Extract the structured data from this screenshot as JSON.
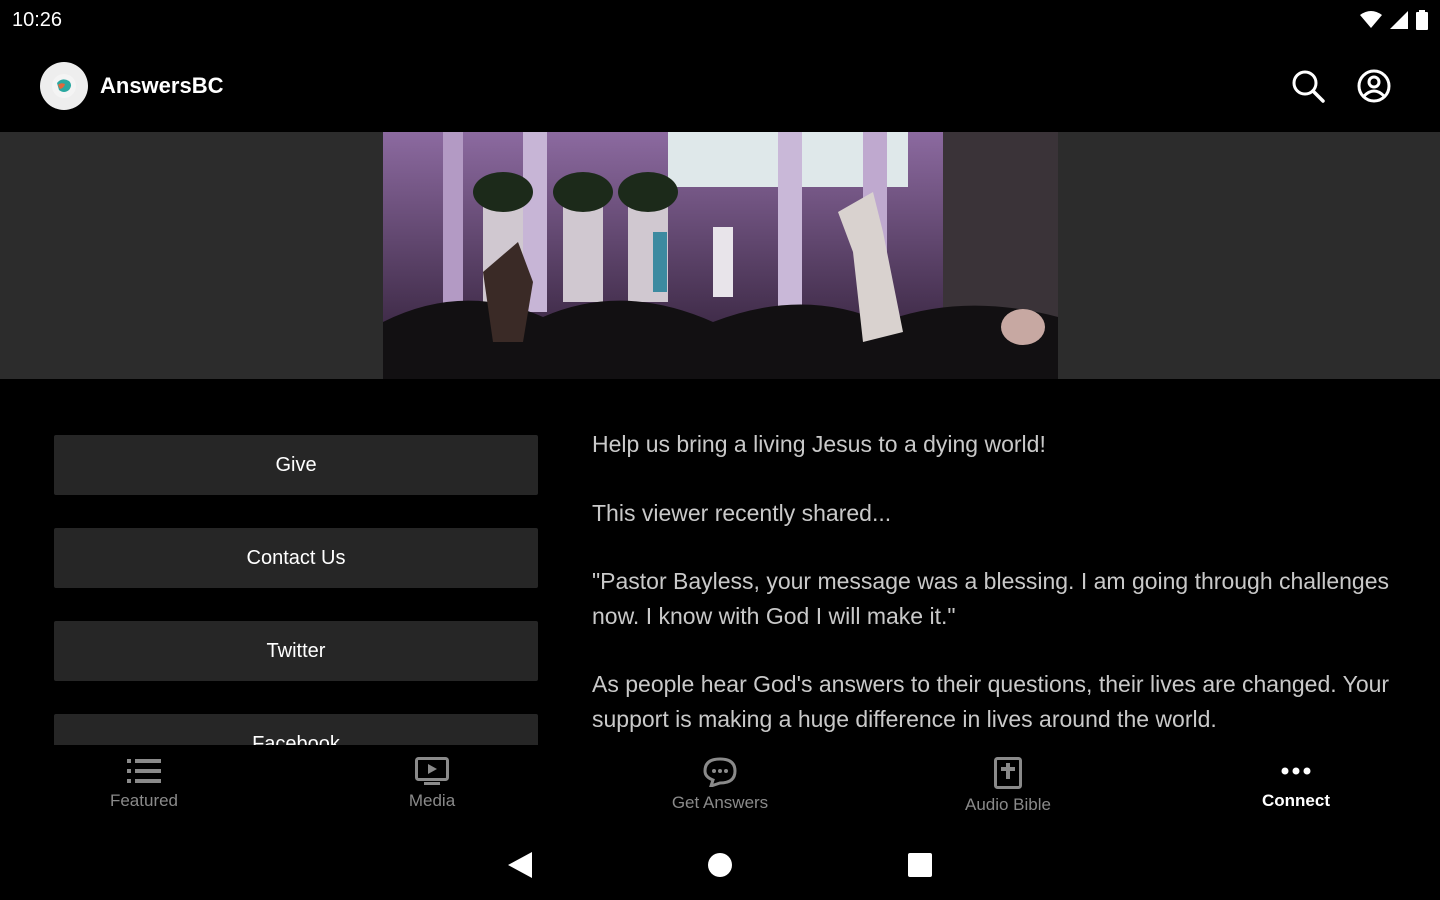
{
  "status": {
    "time": "10:26"
  },
  "app": {
    "title": "AnswersBC"
  },
  "icons": {
    "search": "search-icon",
    "account": "account-icon"
  },
  "links": [
    {
      "label": "Give"
    },
    {
      "label": "Contact Us"
    },
    {
      "label": "Twitter"
    },
    {
      "label": "Facebook"
    }
  ],
  "content": {
    "p1": "Help us bring a living Jesus to a dying world!",
    "p2": "This viewer recently shared...",
    "p3": "\"Pastor Bayless, your message was a blessing. I am going through challenges now. I know with God I will make it.\"",
    "p4": "As people hear God's answers to their questions, their lives are changed. Your support is making a huge difference in lives around the world."
  },
  "nav": [
    {
      "label": "Featured",
      "icon": "list-icon",
      "active": false
    },
    {
      "label": "Media",
      "icon": "tv-icon",
      "active": false
    },
    {
      "label": "Get Answers",
      "icon": "chat-icon",
      "active": false
    },
    {
      "label": "Audio Bible",
      "icon": "bible-icon",
      "active": false
    },
    {
      "label": "Connect",
      "icon": "more-icon",
      "active": true
    }
  ],
  "colors": {
    "background": "#000000",
    "banner_bg": "#2c2c2c",
    "button_bg": "#262626",
    "text_muted": "#c9c9c9",
    "nav_inactive": "#8a8a8a",
    "logo_accent": "#2aa8a0"
  }
}
